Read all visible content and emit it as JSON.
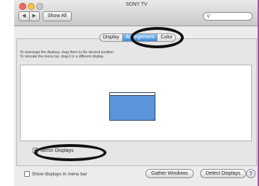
{
  "window": {
    "title": "SONY TV",
    "show_all_label": "Show All",
    "nav_back_icon": "chevron-left-icon",
    "nav_forward_icon": "chevron-right-icon",
    "search_icon": "search-icon",
    "search_placeholder": ""
  },
  "tabs": [
    {
      "label": "Display",
      "selected": false
    },
    {
      "label": "Arrangement",
      "selected": true
    },
    {
      "label": "Color",
      "selected": false
    }
  ],
  "instructions": [
    "To rearrange the displays, drag them to the desired position.",
    "To relocate the menu bar, drag it to a different display."
  ],
  "arrangement": {
    "display_color": "#5b96db"
  },
  "mirror_displays": {
    "label": "Mirror Displays",
    "checked": true
  },
  "show_in_menu_bar": {
    "label": "Show displays in menu bar",
    "checked": false
  },
  "buttons": {
    "gather": "Gather Windows",
    "detect": "Detect Displays",
    "help": "?"
  },
  "annotation_color": "#111111"
}
